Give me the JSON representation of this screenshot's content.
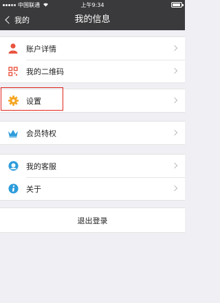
{
  "status_bar": {
    "carrier": "中国联通",
    "time": "上午9:34"
  },
  "nav": {
    "back_label": "我的",
    "title": "我的信息"
  },
  "menu": {
    "account": "账户详情",
    "qrcode": "我的二维码",
    "settings": "设置",
    "vip": "会员特权",
    "service": "我的客服",
    "about": "关于"
  },
  "logout_label": "退出登录",
  "colors": {
    "bar": "#3a3a3c",
    "background": "#f0eff4",
    "highlight_border": "#e2231a",
    "account_icon": "#e8543f",
    "qrcode_icon": "#e8543f",
    "settings_icon": "#f5a623",
    "vip_icon": "#2d9cdb",
    "service_icon": "#2d9cdb",
    "about_icon": "#2d9cdb"
  },
  "icons": {
    "account": "person-icon",
    "qrcode": "qr-code-icon",
    "settings": "gear-icon",
    "vip": "crown-icon",
    "service": "headset-icon",
    "about": "info-icon"
  }
}
